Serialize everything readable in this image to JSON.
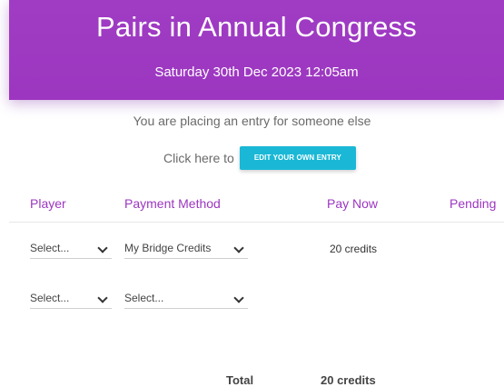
{
  "header": {
    "title": "Pairs in Annual Congress",
    "subtitle": "Saturday 30th Dec 2023 12:05am"
  },
  "notice": "You are placing an entry for someone else",
  "click_row": {
    "text": "Click here to",
    "button": "EDIT YOUR OWN ENTRY"
  },
  "table": {
    "headers": [
      "Player",
      "Payment Method",
      "Pay Now",
      "Pending"
    ],
    "rows": [
      {
        "player": "Select...",
        "payment": "My Bridge Credits",
        "pay_now": "20 credits"
      },
      {
        "player": "Select...",
        "payment": "Select...",
        "pay_now": ""
      }
    ]
  },
  "total": {
    "label": "Total",
    "value": "20 credits"
  },
  "colors": {
    "header": "#9c36c0",
    "button": "#1ab8d6",
    "accent_text": "#9c36c0"
  }
}
